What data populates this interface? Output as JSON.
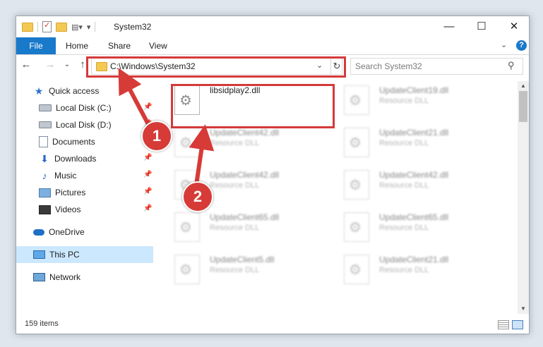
{
  "window": {
    "title": "System32"
  },
  "ribbon": {
    "file": "File",
    "home": "Home",
    "share": "Share",
    "view": "View"
  },
  "address": {
    "path": "C:\\Windows\\System32"
  },
  "search": {
    "placeholder": "Search System32"
  },
  "navpane": {
    "items": [
      {
        "label": "Quick access",
        "icon": "star-icon",
        "pinned": false
      },
      {
        "label": "Local Disk (C:)",
        "icon": "disk-icon",
        "pinned": true
      },
      {
        "label": "Local Disk (D:)",
        "icon": "disk-icon",
        "pinned": true
      },
      {
        "label": "Documents",
        "icon": "documents-icon",
        "pinned": true
      },
      {
        "label": "Downloads",
        "icon": "downloads-icon",
        "pinned": true
      },
      {
        "label": "Music",
        "icon": "music-icon",
        "pinned": true
      },
      {
        "label": "Pictures",
        "icon": "pictures-icon",
        "pinned": true
      },
      {
        "label": "Videos",
        "icon": "videos-icon",
        "pinned": true
      },
      {
        "label": "OneDrive",
        "icon": "onedrive-icon",
        "pinned": false
      },
      {
        "label": "This PC",
        "icon": "pc-icon",
        "pinned": false,
        "selected": true
      },
      {
        "label": "Network",
        "icon": "network-icon",
        "pinned": false
      }
    ]
  },
  "files": [
    {
      "name": "libsidplay2.dll",
      "type": ""
    },
    {
      "name": "UpdateClient19.dll",
      "type": "Resource DLL"
    },
    {
      "name": "UpdateClient42.dll",
      "type": "Resource DLL"
    },
    {
      "name": "UpdateClient21.dll",
      "type": "Resource DLL"
    },
    {
      "name": "UpdateClient42.dll",
      "type": "Resource DLL"
    },
    {
      "name": "UpdateClient42.dll",
      "type": "Resource DLL"
    },
    {
      "name": "UpdateClient65.dll",
      "type": "Resource DLL"
    },
    {
      "name": "UpdateClient65.dll",
      "type": "Resource DLL"
    },
    {
      "name": "UpdateClient5.dll",
      "type": "Resource DLL"
    },
    {
      "name": "UpdateClient21.dll",
      "type": "Resource DLL"
    }
  ],
  "status": {
    "count": "159 items"
  },
  "callouts": {
    "one": "1",
    "two": "2"
  },
  "colors": {
    "accent": "#1979ca",
    "highlight": "#d43a3a",
    "selected": "#cce8ff"
  }
}
